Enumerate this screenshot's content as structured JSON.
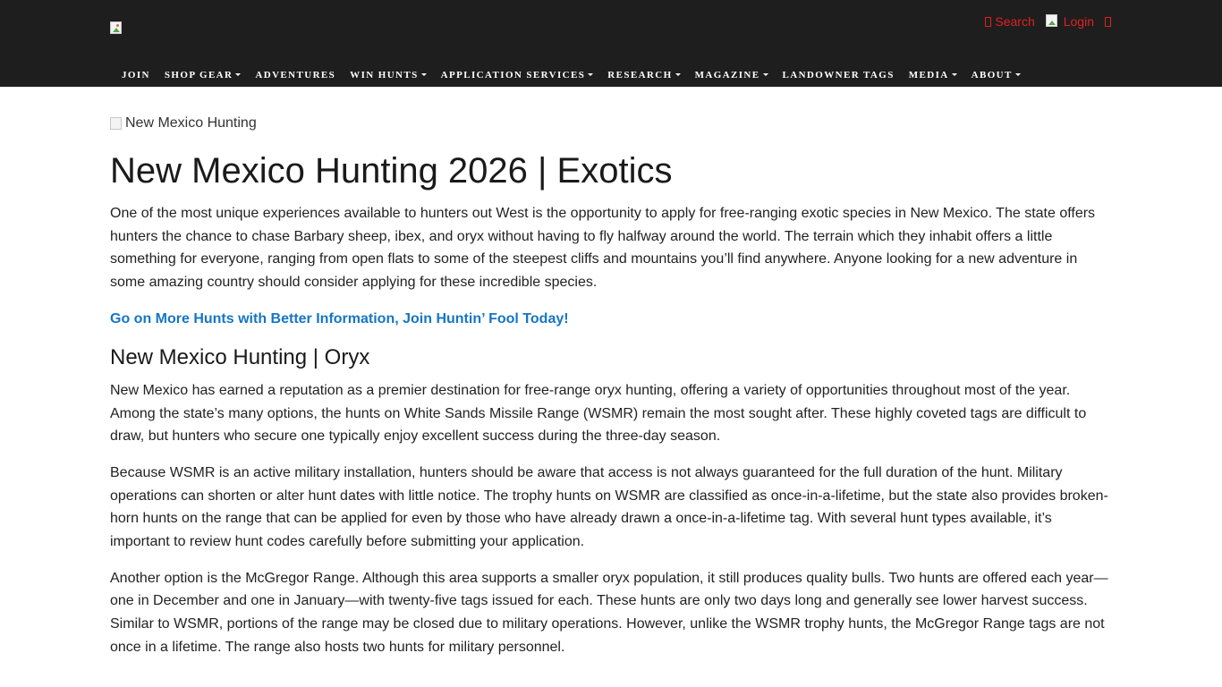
{
  "header": {
    "utility": {
      "search_label": "Search",
      "login_label": "Login"
    },
    "nav": [
      {
        "label": "JOIN",
        "dropdown": false
      },
      {
        "label": "SHOP GEAR",
        "dropdown": true
      },
      {
        "label": "ADVENTURES",
        "dropdown": false
      },
      {
        "label": "WIN HUNTS",
        "dropdown": true
      },
      {
        "label": "APPLICATION SERVICES",
        "dropdown": true
      },
      {
        "label": "RESEARCH",
        "dropdown": true
      },
      {
        "label": "MAGAZINE",
        "dropdown": true
      },
      {
        "label": "LANDOWNER TAGS",
        "dropdown": false
      },
      {
        "label": "MEDIA",
        "dropdown": true
      },
      {
        "label": "ABOUT",
        "dropdown": true
      }
    ]
  },
  "hero_image_alt": "New Mexico Hunting",
  "page_title": "New Mexico Hunting 2026 | Exotics",
  "intro": "One of the most unique experiences available to hunters out West is the opportunity to apply for free-ranging exotic species in New Mexico. The state offers hunters the chance to chase Barbary sheep, ibex, and oryx without having to fly halfway around the world. The terrain which they inhabit offers a little something for everyone, ranging from open flats to some of the steepest cliffs and mountains you’ll find anywhere. Anyone looking for a new adventure in some amazing country should consider applying for these incredible species.",
  "cta_link": "Go on More Hunts with Better Information, Join Huntin’ Fool Today!",
  "section": {
    "heading": "New Mexico Hunting | Oryx",
    "paragraphs": [
      "New Mexico has earned a reputation as a premier destination for free-range oryx hunting, offering a variety of opportunities throughout most of the year. Among the state’s many options, the hunts on White Sands Missile Range (WSMR) remain the most sought after. These highly coveted tags are difficult to draw, but hunters who secure one typically enjoy excellent success during the three-day season.",
      "Because WSMR is an active military installation, hunters should be aware that access is not always guaranteed for the full duration of the hunt. Military operations can shorten or alter hunt dates with little notice. The trophy hunts on WSMR are classified as once-in-a-lifetime, but the state also provides broken-horn hunts on the range that can be applied for even by those who have already drawn a once-in-a-lifetime tag. With several hunt types available, it’s important to review hunt codes carefully before submitting your application.",
      "Another option is the McGregor Range. Although this area supports a smaller oryx population, it still produces quality bulls. Two hunts are offered each year—one in December and one in January—with twenty-five tags issued for each. These hunts are only two days long and generally see lower harvest success. Similar to WSMR, portions of the range may be closed due to military operations. However, unlike the WSMR trophy hunts, the McGregor Range tags are not once in a lifetime. The range also hosts two hunts for military personnel."
    ]
  },
  "colors": {
    "header_bg": "#1e1e1e",
    "utility_red": "#e02020",
    "link_blue": "#1576c4"
  }
}
